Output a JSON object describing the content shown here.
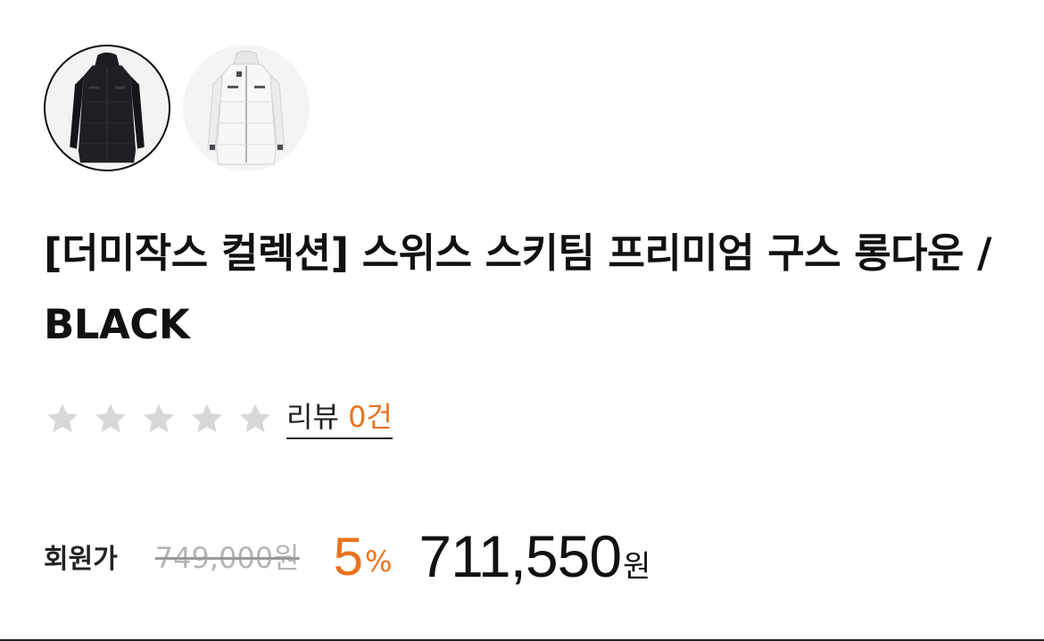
{
  "product": {
    "title": "[더미작스 컬렉션] 스위스 스키팀 프리미엄 구스 롱다운 / BLACK",
    "color_options": [
      {
        "name": "black-coat",
        "color": "#1c1d22",
        "selected": true
      },
      {
        "name": "white-coat",
        "color": "#f2f2f2",
        "selected": false
      }
    ]
  },
  "rating": {
    "stars_filled": 0,
    "stars_total": 5,
    "star_color": "#d8d8d8",
    "review_label": "리뷰",
    "review_count": "0건"
  },
  "price": {
    "member_label": "회원가",
    "original": "749,000원",
    "discount_value": "5",
    "discount_unit": "%",
    "sale_value": "711,550",
    "sale_unit": "원",
    "accent_color": "#e8731d"
  }
}
